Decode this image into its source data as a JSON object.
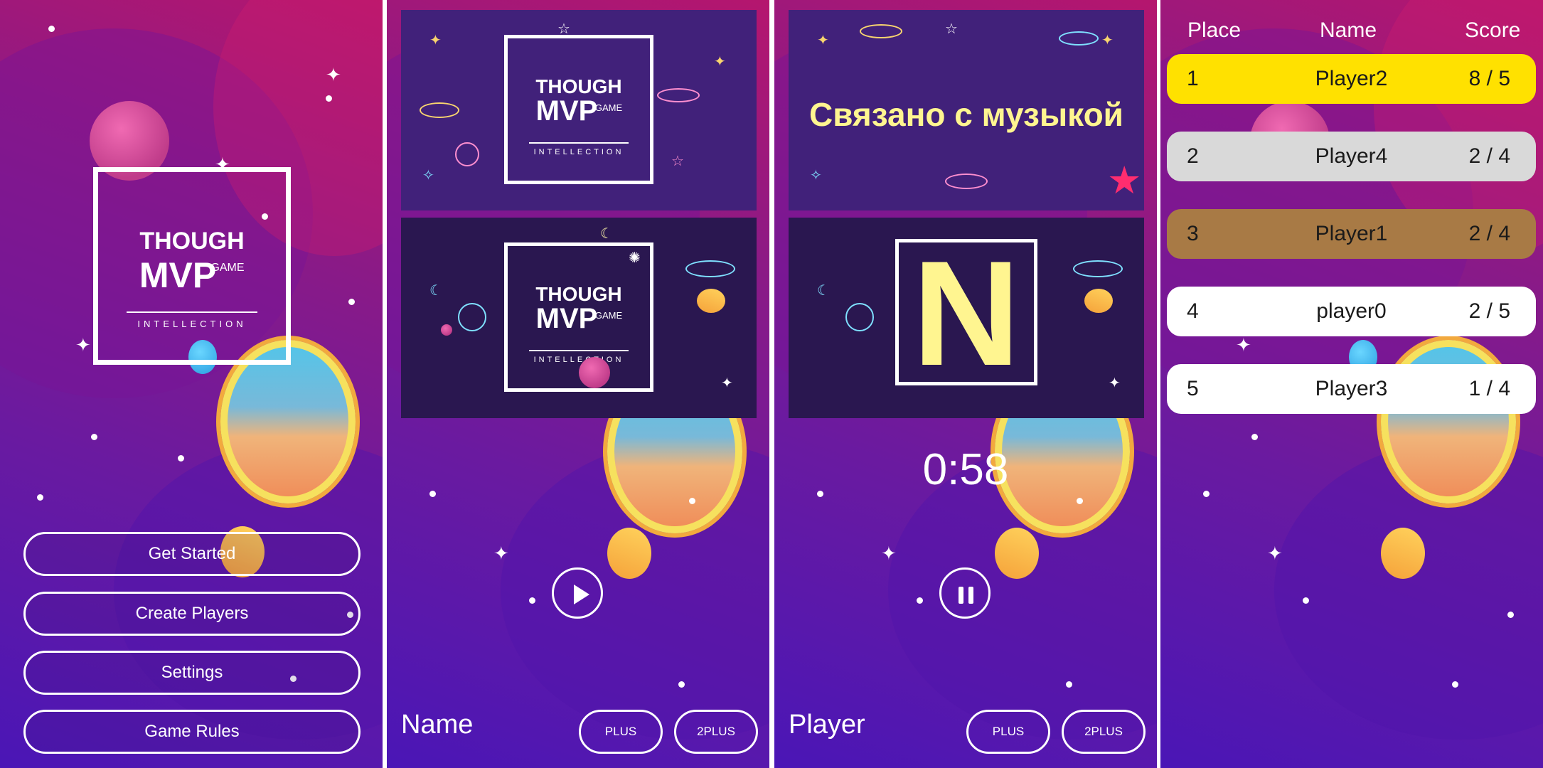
{
  "menu": {
    "logo": {
      "line1": "THOUGH",
      "line2": "MVP",
      "game": "GAME",
      "sub": "INTELLECTION"
    },
    "buttons": [
      "Get Started",
      "Create Players",
      "Settings",
      "Game Rules"
    ]
  },
  "game_start": {
    "logo": {
      "line1": "THOUGH",
      "line2": "MVP",
      "game": "GAME",
      "sub": "INTELLECTION"
    },
    "name_label": "Name",
    "plus_label": "PLUS",
    "two_plus_label": "2PLUS"
  },
  "game_play": {
    "category": "Связано с музыкой",
    "letter": "N",
    "timer": "0:58",
    "player_label": "Player",
    "plus_label": "PLUS",
    "two_plus_label": "2PLUS"
  },
  "leaderboard": {
    "headers": {
      "place": "Place",
      "name": "Name",
      "score": "Score"
    },
    "rows": [
      {
        "place": "1",
        "name": "Player2",
        "score": "8 / 5",
        "color": "#ffe100"
      },
      {
        "place": "2",
        "name": "Player4",
        "score": "2 / 4",
        "color": "#d9d9d9"
      },
      {
        "place": "3",
        "name": "Player1",
        "score": "2 / 4",
        "color": "#a87a45"
      },
      {
        "place": "4",
        "name": "player0",
        "score": "2 / 5",
        "color": "#ffffff"
      },
      {
        "place": "5",
        "name": "Player3",
        "score": "1 / 4",
        "color": "#ffffff"
      }
    ]
  },
  "colors": {
    "accent_yellow": "#fff590",
    "star_pink": "#ff2d6f"
  }
}
